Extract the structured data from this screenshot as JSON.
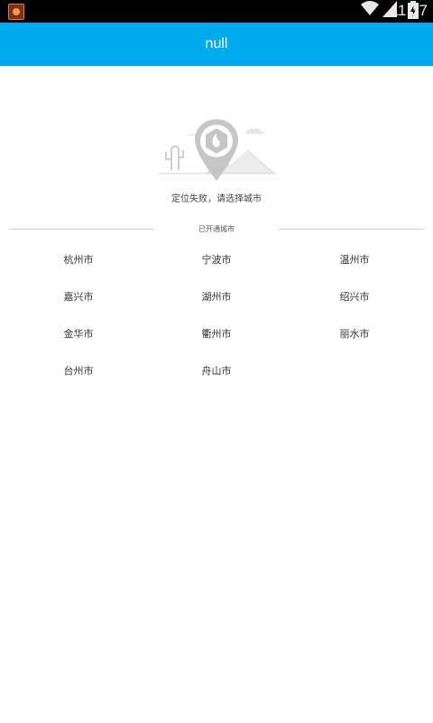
{
  "status_bar": {
    "time": "11:37",
    "icons": [
      "app-icon",
      "wifi-icon",
      "signal-icon",
      "battery-icon"
    ]
  },
  "header": {
    "title": "null",
    "background_color": "#00aaef"
  },
  "location": {
    "illustration_icon": "location-pin-icon",
    "failure_message": "定位失败，请选择城市"
  },
  "cities_section": {
    "label": "已开通城市",
    "cities": [
      "杭州市",
      "宁波市",
      "温州市",
      "嘉兴市",
      "湖州市",
      "绍兴市",
      "金华市",
      "衢州市",
      "丽水市",
      "台州市",
      "舟山市"
    ]
  }
}
